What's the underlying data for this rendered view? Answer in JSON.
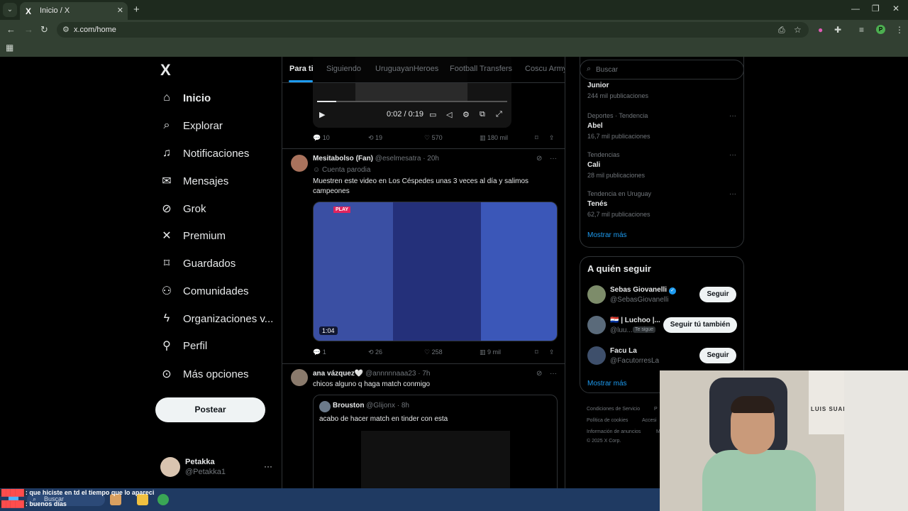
{
  "browser": {
    "tab_title": "Inicio / X",
    "tab_favicon": "X",
    "url": "x.com/home",
    "profile_letter": "P"
  },
  "nav": {
    "logo": "X",
    "items": [
      {
        "label": "Inicio",
        "icon": "home-icon"
      },
      {
        "label": "Explorar",
        "icon": "search-icon"
      },
      {
        "label": "Notificaciones",
        "icon": "bell-icon"
      },
      {
        "label": "Mensajes",
        "icon": "mail-icon"
      },
      {
        "label": "Grok",
        "icon": "grok-icon"
      },
      {
        "label": "Premium",
        "icon": "x-icon"
      },
      {
        "label": "Guardados",
        "icon": "bookmark-icon"
      },
      {
        "label": "Comunidades",
        "icon": "people-icon"
      },
      {
        "label": "Organizaciones v...",
        "icon": "lightning-icon"
      },
      {
        "label": "Perfil",
        "icon": "person-icon"
      },
      {
        "label": "Más opciones",
        "icon": "more-icon"
      }
    ],
    "post_button": "Postear",
    "user": {
      "name": "Petakka",
      "handle": "@Petakka1"
    }
  },
  "feed": {
    "tabs": [
      "Para ti",
      "Siguiendo",
      "UruguayanHeroes",
      "Football Transfers",
      "Coscu Army"
    ],
    "video": {
      "time": "0:02 / 0:19",
      "progress": 0.1
    },
    "tweet0_actions": {
      "replies": "10",
      "reposts": "19",
      "likes": "570",
      "views": "180 mil"
    },
    "tweet1": {
      "name": "Mesitabolso (Fan)",
      "handle": "@eselmesatra",
      "time": "· 20h",
      "label": "Cuenta parodia",
      "text": "Muestren este video en Los Céspedes unas 3 veces al día y salimos campeones",
      "duration": "1:04",
      "actions": {
        "replies": "1",
        "reposts": "26",
        "likes": "258",
        "views": "9 mil"
      }
    },
    "tweet2": {
      "name": "ana vázquez🤍",
      "handle": "@annnnnaaa23",
      "time": "· 7h",
      "text": "chicos alguno q haga match conmigo",
      "quote": {
        "name": "Brouston",
        "handle": "@Glijonx",
        "time": "· 8h",
        "text": "acabo de hacer match en tinder con esta"
      }
    }
  },
  "sidebar": {
    "search_placeholder": "Buscar",
    "trends": [
      {
        "category": "",
        "name": "Junior",
        "count": "244 mil publicaciones"
      },
      {
        "category": "Deportes · Tendencia",
        "name": "Abel",
        "count": "16,7 mil publicaciones"
      },
      {
        "category": "Tendencias",
        "name": "Cali",
        "count": "28 mil publicaciones"
      },
      {
        "category": "Tendencia en Uruguay",
        "name": "Tenés",
        "count": "62,7 mil publicaciones"
      }
    ],
    "show_more": "Mostrar más",
    "who_to_follow": {
      "title": "A quién seguir",
      "users": [
        {
          "name": "Sebas Giovanelli",
          "handle": "@SebasGiovanelli",
          "button": "Seguir"
        },
        {
          "name": "🇵🇾 | Luchoo |...",
          "handle": "@luu...",
          "badge": "Te sigue",
          "button": "Seguir tú también"
        },
        {
          "name": "Facu La",
          "handle": "@FacutorresLa",
          "button": "Seguir"
        }
      ],
      "show_more": "Mostrar más"
    },
    "footer": {
      "line1": "Condiciones de Servicio",
      "line1b": "P",
      "line2": "Política de cookies",
      "line2b": "Accesi",
      "line3": "Información de anuncios",
      "line3b": "M",
      "copyright": "© 2025 X Corp."
    }
  },
  "overlay": {
    "poster_text": "LUIS SUAREZ",
    "chat": [
      {
        "user": "",
        "text": ": que hiciste en td el tiempo que lo apareci"
      },
      {
        "user": "",
        "text": ": buenos días"
      }
    ]
  },
  "taskbar": {
    "search_placeholder": "Buscar"
  }
}
